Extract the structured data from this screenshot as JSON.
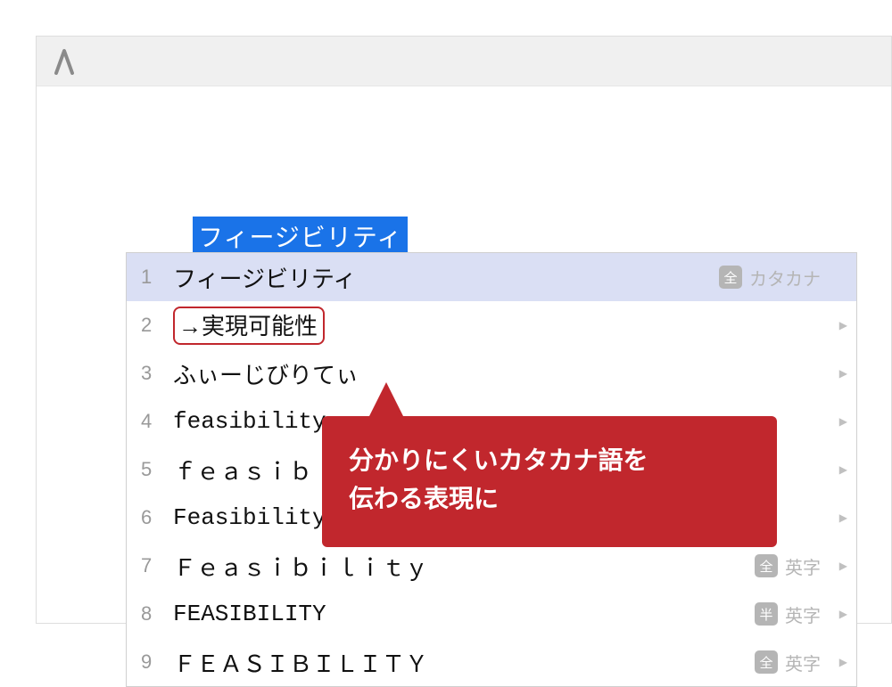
{
  "input": {
    "selected_text": "フィージビリティ"
  },
  "candidates": [
    {
      "num": "1",
      "text": "フィージビリティ",
      "badge": "全",
      "hint": "カタカナ",
      "selected": true,
      "chevron": false,
      "class": ""
    },
    {
      "num": "2",
      "text": "→実現可能性",
      "highlighted": true,
      "chevron": true,
      "class": ""
    },
    {
      "num": "3",
      "text": "ふぃーじびりてぃ",
      "chevron": true,
      "class": ""
    },
    {
      "num": "4",
      "text": "feasibility",
      "chevron": true,
      "class": "mono"
    },
    {
      "num": "5",
      "text": "ｆｅａｓｉｂｉｌｉｔｙ",
      "chevron": true,
      "class": "mono"
    },
    {
      "num": "6",
      "text": "Feasibility",
      "chevron": true,
      "class": "mono"
    },
    {
      "num": "7",
      "text": "Ｆｅａｓｉｂｉｌｉｔｙ",
      "badge": "全",
      "hint": "英字",
      "chevron": true,
      "class": "mono"
    },
    {
      "num": "8",
      "text": "FEASIBILITY",
      "badge": "半",
      "hint": "英字",
      "chevron": true,
      "class": "mono"
    },
    {
      "num": "9",
      "text": "ＦＥＡＳＩＢＩＬＩＴＹ",
      "badge": "全",
      "hint": "英字",
      "chevron": true,
      "class": "mono"
    }
  ],
  "callout": {
    "line1": "分かりにくいカタカナ語を",
    "line2": "伝わる表現に"
  }
}
